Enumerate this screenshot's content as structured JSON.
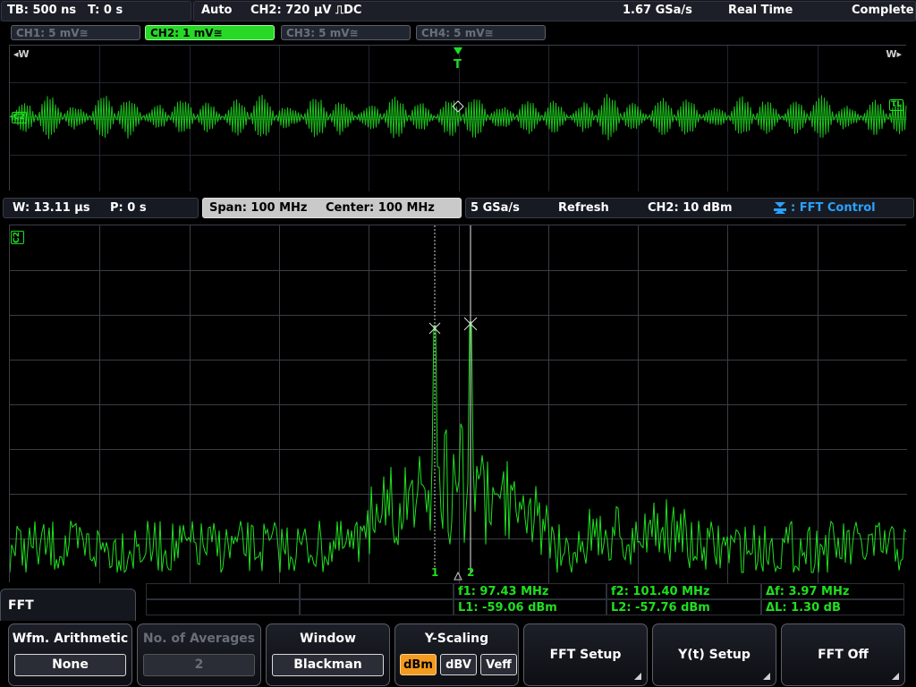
{
  "status": {
    "timebase": "TB: 500 ns",
    "trigger_time": "T: 0 s",
    "trigger_mode": "Auto",
    "trigger_source": "CH2: 720 µV ⎍DC",
    "sample_rate": "1.67 GSa/s",
    "acq_mode": "Real Time",
    "acq_state": "Complete"
  },
  "channels": [
    {
      "label": "CH1: 5 mV≅",
      "active": false
    },
    {
      "label": "CH2: 1 mV≅",
      "active": true
    },
    {
      "label": "CH3: 5 mV≅",
      "active": false
    },
    {
      "label": "CH4: 5 mV≅",
      "active": false
    }
  ],
  "time_panel": {
    "left_marker": "◂W",
    "right_marker": "W▸",
    "trigger_marker": "T",
    "channel_marker": "C2",
    "trigger_level_marker": "TL"
  },
  "fft_info": {
    "window_width": "W: 13.11 µs",
    "position": "P: 0 s",
    "span": "Span: 100 MHz",
    "center": "Center: 100 MHz",
    "fft_rate": "5 GSa/s",
    "mode": "Refresh",
    "ref_level": "CH2: 10 dBm",
    "control": ": FFT Control"
  },
  "fft_panel": {
    "channel_marker": "C2",
    "cursor1_label": "1",
    "cursor2_label": "2"
  },
  "measurements": {
    "f1": "f1: 97.43 MHz",
    "l1": "L1: -59.06 dBm",
    "f2": "f2: 101.40 MHz",
    "l2": "L2: -57.76 dBm",
    "df": "Δf: 3.97 MHz",
    "dl": "ΔL: 1.30 dB"
  },
  "menu": {
    "title": "FFT",
    "wfm_arithmetic_title": "Wfm. Arithmetic",
    "wfm_arithmetic_value": "None",
    "averages_title": "No. of Averages",
    "averages_value": "2",
    "window_title": "Window",
    "window_value": "Blackman",
    "yscaling_title": "Y-Scaling",
    "yscaling_options": [
      "dBm",
      "dBV",
      "Veff"
    ],
    "yscaling_selected": "dBm",
    "fft_setup": "FFT Setup",
    "yt_setup": "Y(t) Setup",
    "fft_off": "FFT Off"
  },
  "colors": {
    "trace": "#1fe01f",
    "grid": "#3a3d44",
    "accent": "#2aa2ff",
    "selected": "#f39a20"
  }
}
